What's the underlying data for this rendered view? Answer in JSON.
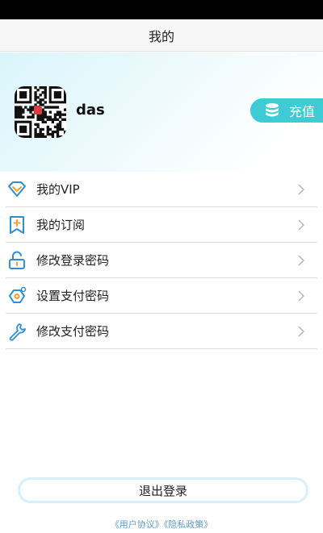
{
  "header": {
    "title": "我的"
  },
  "profile": {
    "username": "das"
  },
  "recharge": {
    "label": "充值",
    "icon": "database-icon"
  },
  "menu": {
    "items": [
      {
        "label": "我的VIP",
        "icon": "vip-diamond-icon"
      },
      {
        "label": "我的订阅",
        "icon": "bookmark-plus-icon"
      },
      {
        "label": "修改登录密码",
        "icon": "unlock-icon"
      },
      {
        "label": "设置支付密码",
        "icon": "pay-settings-icon"
      },
      {
        "label": "修改支付密码",
        "icon": "wrench-icon"
      }
    ]
  },
  "footer": {
    "logout_label": "退出登录",
    "user_agreement": "《用户协议》",
    "privacy_policy": "《隐私政策》"
  },
  "colors": {
    "accent": "#3ecbd6",
    "icon_blue": "#2f8fd6",
    "icon_orange": "#f0a030",
    "link": "#5aa0c8"
  }
}
